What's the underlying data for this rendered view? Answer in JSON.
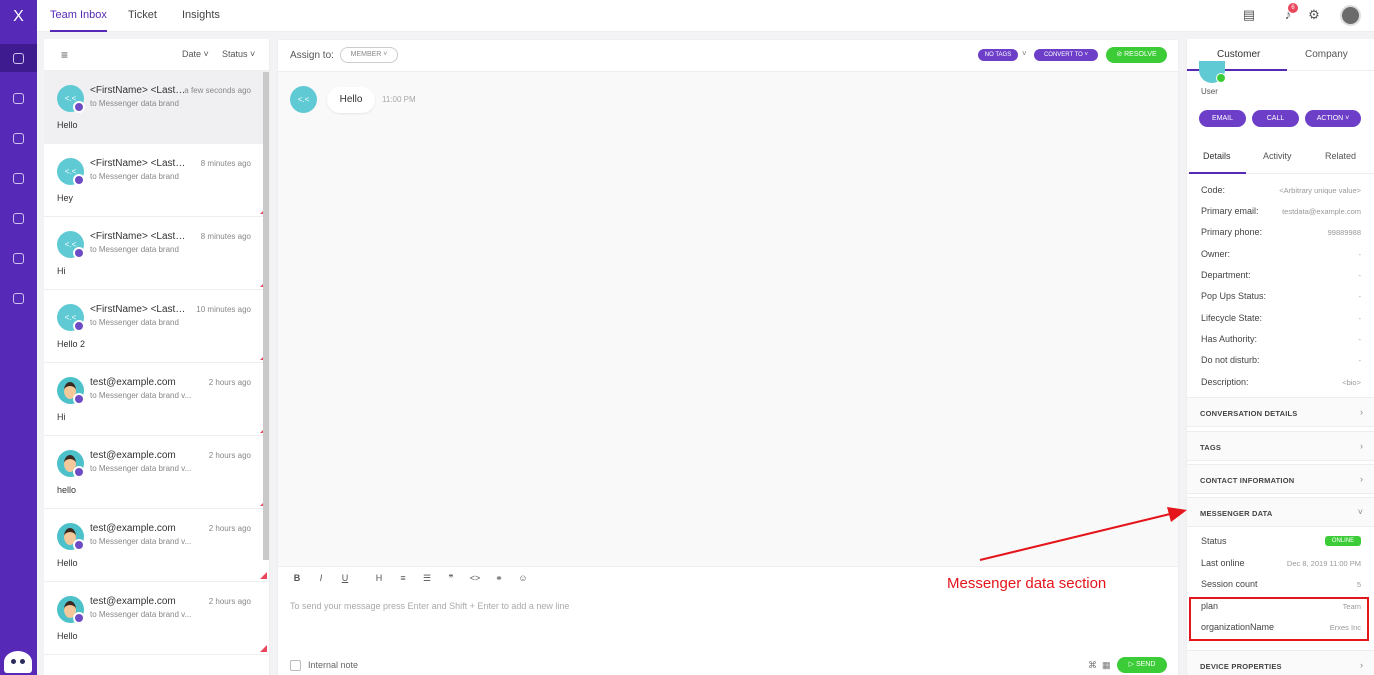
{
  "nav": {
    "logo": "X",
    "items": [
      "chat-icon",
      "bulb-icon",
      "refresh-icon",
      "people-icon",
      "laptop-icon",
      "megaphone-icon",
      "calendar-icon"
    ]
  },
  "topbar": {
    "tabs": [
      {
        "label": "Team Inbox"
      },
      {
        "label": "Ticket"
      },
      {
        "label": "Insights"
      }
    ],
    "notif_count": "6"
  },
  "list": {
    "header": {
      "menu_icon": "menu-icon",
      "filter_date": "Date",
      "filter_status": "Status"
    },
    "conversations": [
      {
        "avatar": "<.<",
        "name": "<FirstName> <LastName>",
        "time": "a few seconds ago",
        "sub": "to Messenger data brand",
        "msg": "Hello"
      },
      {
        "avatar": "<.<",
        "name": "<FirstName> <LastName>",
        "time": "8 minutes ago",
        "sub": "to Messenger data brand",
        "msg": "Hey"
      },
      {
        "avatar": "<.<",
        "name": "<FirstName> <LastName>",
        "time": "8 minutes ago",
        "sub": "to Messenger data brand",
        "msg": "Hi"
      },
      {
        "avatar": "<.<",
        "name": "<FirstName> <LastName>",
        "time": "10 minutes ago",
        "sub": "to Messenger data brand",
        "msg": "Hello 2"
      },
      {
        "avatar": "",
        "name": "test@example.com",
        "time": "2 hours ago",
        "sub": "to Messenger data brand v...",
        "msg": "Hi"
      },
      {
        "avatar": "",
        "name": "test@example.com",
        "time": "2 hours ago",
        "sub": "to Messenger data brand v...",
        "msg": "hello"
      },
      {
        "avatar": "",
        "name": "test@example.com",
        "time": "2 hours ago",
        "sub": "to Messenger data brand v...",
        "msg": "Hello"
      },
      {
        "avatar": "",
        "name": "test@example.com",
        "time": "2 hours ago",
        "sub": "to Messenger data brand v...",
        "msg": "Hello"
      }
    ]
  },
  "chat": {
    "assign_label": "Assign to:",
    "member": "MEMBER",
    "no_tags": "NO TAGS",
    "convert": "CONVERT TO",
    "resolve": "RESOLVE",
    "message": {
      "avatar": "<.<",
      "text": "Hello",
      "time": "11:00 PM"
    },
    "editor_placeholder": "To send your message press Enter and Shift + Enter to add a new line",
    "internal_note": "Internal note",
    "send": "SEND",
    "toolbar": [
      "B",
      "I",
      "U",
      "H",
      "≡",
      "☰",
      "❞",
      "<>",
      "⚭",
      "☺"
    ]
  },
  "sidebar": {
    "tabs": [
      "Customer",
      "Company"
    ],
    "user_label": "User",
    "actions": [
      "EMAIL",
      "CALL",
      "ACTION"
    ],
    "detail_tabs": [
      "Details",
      "Activity",
      "Related"
    ],
    "details": [
      {
        "k": "Code:",
        "v": "<Arbitrary unique value>"
      },
      {
        "k": "Primary email:",
        "v": "testdata@example.com"
      },
      {
        "k": "Primary phone:",
        "v": "99889988"
      },
      {
        "k": "Owner:",
        "v": "-"
      },
      {
        "k": "Department:",
        "v": "-"
      },
      {
        "k": "Pop Ups Status:",
        "v": "-"
      },
      {
        "k": "Lifecycle State:",
        "v": "-"
      },
      {
        "k": "Has Authority:",
        "v": "-"
      },
      {
        "k": "Do not disturb:",
        "v": "-"
      },
      {
        "k": "Description:",
        "v": "<bio>"
      }
    ],
    "sections": [
      "CONVERSATION DETAILS",
      "TAGS",
      "CONTACT INFORMATION",
      "MESSENGER DATA",
      "DEVICE PROPERTIES"
    ],
    "messenger": [
      {
        "k": "Status",
        "v": "ONLINE"
      },
      {
        "k": "Last online",
        "v": "Dec 8, 2019 11:00 PM"
      },
      {
        "k": "Session count",
        "v": "5"
      },
      {
        "k": "plan",
        "v": "Team"
      },
      {
        "k": "organizationName",
        "v": "Erxes Inc"
      }
    ]
  },
  "annotation": {
    "text": "Messenger data section",
    "color": "#e4151b"
  },
  "colors": {
    "brand": "#5629B6",
    "accent": "#3ccc38",
    "alert": "#ea475d"
  }
}
